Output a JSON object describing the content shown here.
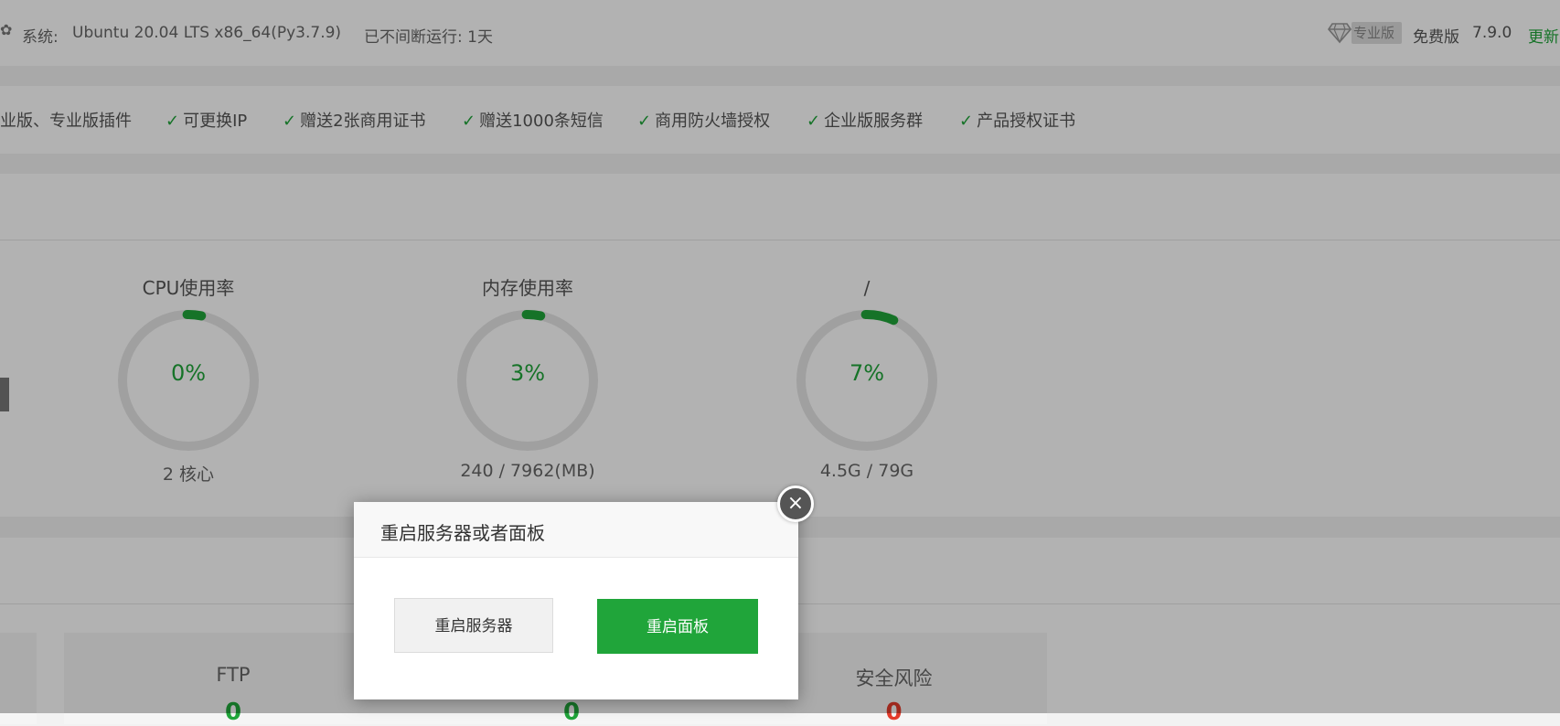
{
  "topbar": {
    "system_label": "系统:",
    "system_value": "Ubuntu 20.04 LTS x86_64(Py3.7.9)",
    "uptime": "已不间断运行: 1天",
    "pro_badge": "专业版",
    "free_label": "免费版",
    "version": "7.9.0",
    "update_link": "更新"
  },
  "features": [
    "业版、专业版插件",
    "可更换IP",
    "赠送2张商用证书",
    "赠送1000条短信",
    "商用防火墙授权",
    "企业版服务群",
    "产品授权证书"
  ],
  "gauges": [
    {
      "title": "CPU使用率",
      "value": "0%",
      "sub": "2 核心",
      "fraction": 0.0
    },
    {
      "title": "内存使用率",
      "value": "3%",
      "sub": "240 / 7962(MB)",
      "fraction": 0.03
    },
    {
      "title": "/",
      "value": "7%",
      "sub": "4.5G / 79G",
      "fraction": 0.07
    }
  ],
  "cards": [
    {
      "title": "FTP",
      "num": "0"
    },
    {
      "title": "",
      "num": "0"
    },
    {
      "title": "安全风险",
      "num": "0"
    }
  ],
  "dialog": {
    "title": "重启服务器或者面板",
    "restart_server": "重启服务器",
    "restart_panel": "重启面板",
    "close": "×"
  },
  "colors": {
    "accent": "#20a53a",
    "danger": "#e33b2b",
    "track": "#e6e6e6"
  }
}
